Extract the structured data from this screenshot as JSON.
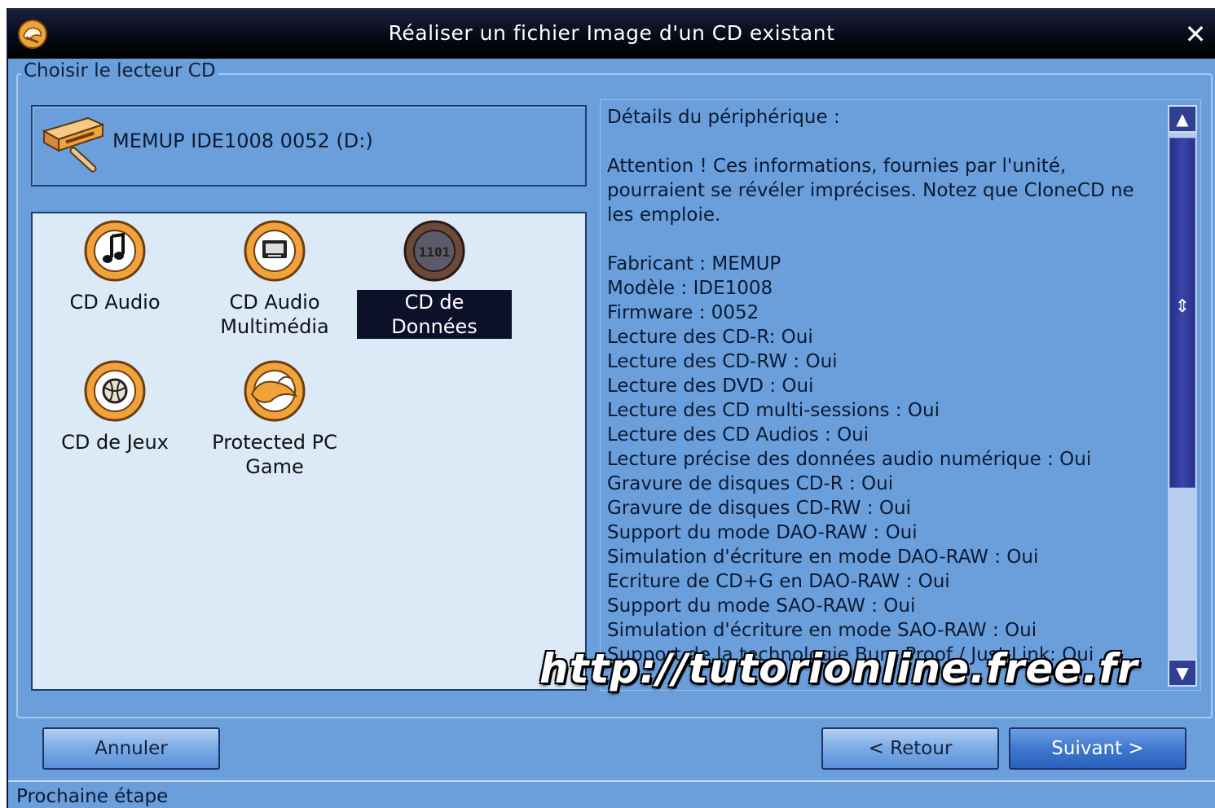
{
  "window": {
    "title": "Réaliser un fichier Image d'un CD existant",
    "close_glyph": "✕"
  },
  "drive_group": {
    "label": "Choisir le lecteur CD",
    "drive": "MEMUP IDE1008 0052 (D:)"
  },
  "cd_types": [
    {
      "label": "CD Audio",
      "icon": "music-note-icon",
      "selected": false
    },
    {
      "label": "CD Audio Multimédia",
      "icon": "monitor-icon",
      "selected": false
    },
    {
      "label": "CD de Données",
      "icon": "binary-data-icon",
      "selected": true
    },
    {
      "label": "CD de Jeux",
      "icon": "game-ball-icon",
      "selected": false
    },
    {
      "label": "Protected PC Game",
      "icon": "protected-game-icon",
      "selected": false
    }
  ],
  "details": {
    "text": "Détails du périphérique :\n\nAttention ! Ces informations, fournies par l'unité, pourraient se révéler imprécises. Notez que CloneCD ne les emploie.\n\nFabricant : MEMUP\nModèle : IDE1008\nFirmware : 0052\nLecture des CD-R: Oui\nLecture des CD-RW : Oui\nLecture des DVD : Oui\nLecture des CD multi-sessions : Oui\nLecture des CD Audios : Oui\nLecture précise des données audio numérique : Oui\nGravure de disques CD-R : Oui\nGravure de disques CD-RW : Oui\nSupport du mode DAO-RAW : Oui\nSimulation d'écriture en mode DAO-RAW : Oui\nEcriture de CD+G en DAO-RAW : Oui\nSupport du mode SAO-RAW : Oui\nSimulation d'écriture en mode SAO-RAW : Oui\nSupport de la technologie Burn Proof / Just Link: Oui"
  },
  "watermark": "http://tutorionline.free.fr",
  "buttons": {
    "cancel": "Annuler",
    "back": "< Retour",
    "next": "Suivant >"
  },
  "status": "Prochaine étape",
  "colors": {
    "window_bg": "#6a9fdc",
    "titlebar": "#000000",
    "selection": "#0c1129",
    "icon_orange": "#f2a23a"
  }
}
